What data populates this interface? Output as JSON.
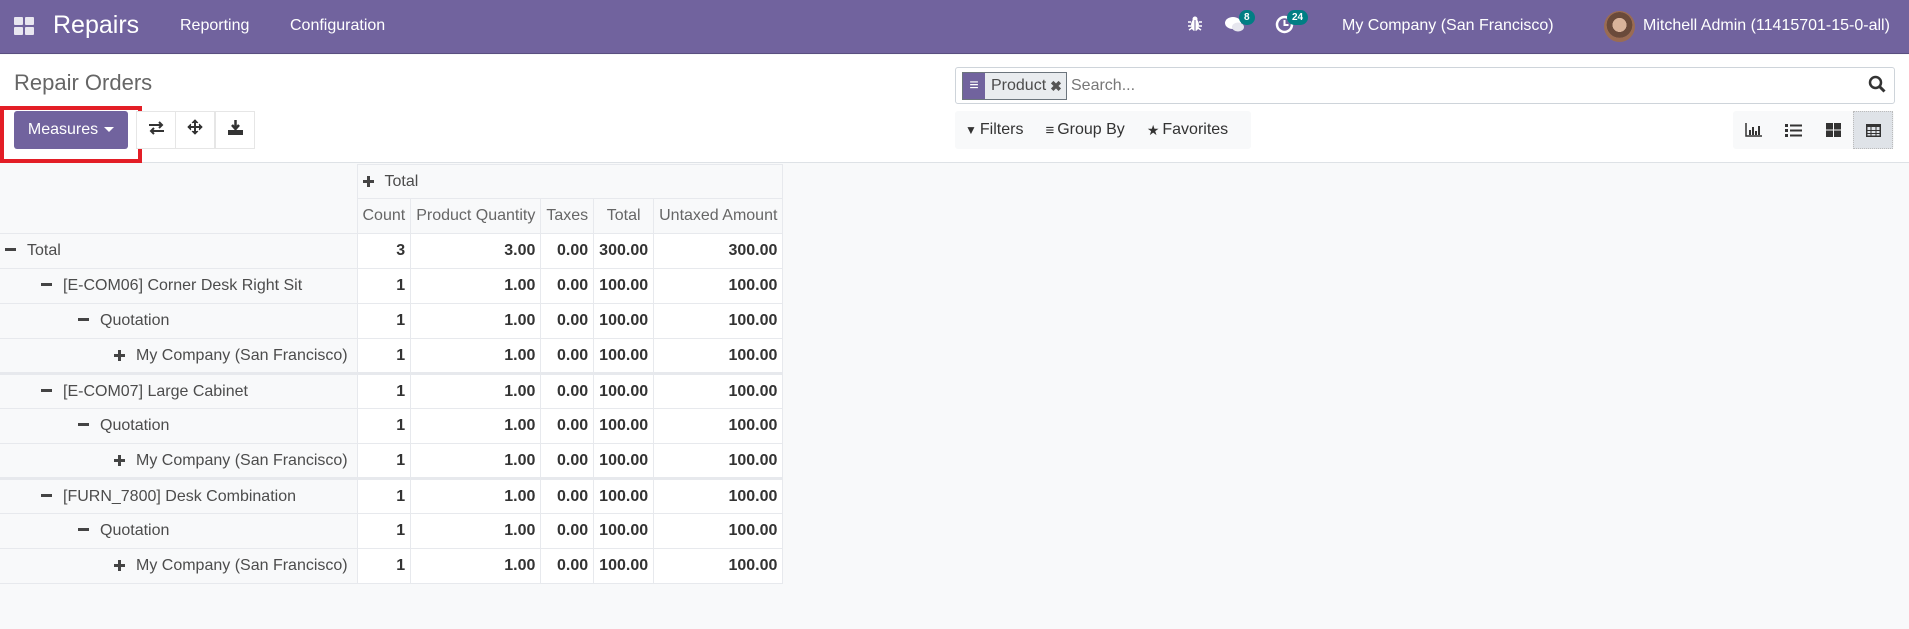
{
  "navbar": {
    "app_name": "Repairs",
    "menu": [
      "Reporting",
      "Configuration"
    ],
    "messages_count": "8",
    "activities_count": "24",
    "company": "My Company (San Francisco)",
    "user": "Mitchell Admin (11415701-15-0-all)"
  },
  "control_panel": {
    "title": "Repair Orders",
    "measures_label": "Measures",
    "search": {
      "facet_value": "Product",
      "placeholder": "Search..."
    },
    "filters_label": "Filters",
    "groupby_label": "Group By",
    "favorites_label": "Favorites",
    "views": [
      "graph",
      "list",
      "kanban",
      "pivot"
    ],
    "active_view": "pivot"
  },
  "colors": {
    "brand": "#71639e",
    "badge": "#017e84",
    "highlight": "#e31e26"
  },
  "pivot": {
    "column_header": "Total",
    "measures": [
      "Count",
      "Product Quantity",
      "Taxes",
      "Total",
      "Untaxed Amount"
    ],
    "rows": [
      {
        "label": "Total",
        "level": 0,
        "expanded": true,
        "values": [
          "3",
          "3.00",
          "0.00",
          "300.00",
          "300.00"
        ]
      },
      {
        "label": "[E-COM06] Corner Desk Right Sit",
        "level": 1,
        "expanded": true,
        "values": [
          "1",
          "1.00",
          "0.00",
          "100.00",
          "100.00"
        ]
      },
      {
        "label": "Quotation",
        "level": 2,
        "expanded": true,
        "values": [
          "1",
          "1.00",
          "0.00",
          "100.00",
          "100.00"
        ]
      },
      {
        "label": "My Company (San Francisco)",
        "level": 3,
        "expanded": false,
        "values": [
          "1",
          "1.00",
          "0.00",
          "100.00",
          "100.00"
        ]
      },
      {
        "label": "[E-COM07] Large Cabinet",
        "level": 1,
        "expanded": true,
        "values": [
          "1",
          "1.00",
          "0.00",
          "100.00",
          "100.00"
        ]
      },
      {
        "label": "Quotation",
        "level": 2,
        "expanded": true,
        "values": [
          "1",
          "1.00",
          "0.00",
          "100.00",
          "100.00"
        ]
      },
      {
        "label": "My Company (San Francisco)",
        "level": 3,
        "expanded": false,
        "values": [
          "1",
          "1.00",
          "0.00",
          "100.00",
          "100.00"
        ]
      },
      {
        "label": "[FURN_7800] Desk Combination",
        "level": 1,
        "expanded": true,
        "values": [
          "1",
          "1.00",
          "0.00",
          "100.00",
          "100.00"
        ]
      },
      {
        "label": "Quotation",
        "level": 2,
        "expanded": true,
        "values": [
          "1",
          "1.00",
          "0.00",
          "100.00",
          "100.00"
        ]
      },
      {
        "label": "My Company (San Francisco)",
        "level": 3,
        "expanded": false,
        "values": [
          "1",
          "1.00",
          "0.00",
          "100.00",
          "100.00"
        ]
      }
    ]
  }
}
